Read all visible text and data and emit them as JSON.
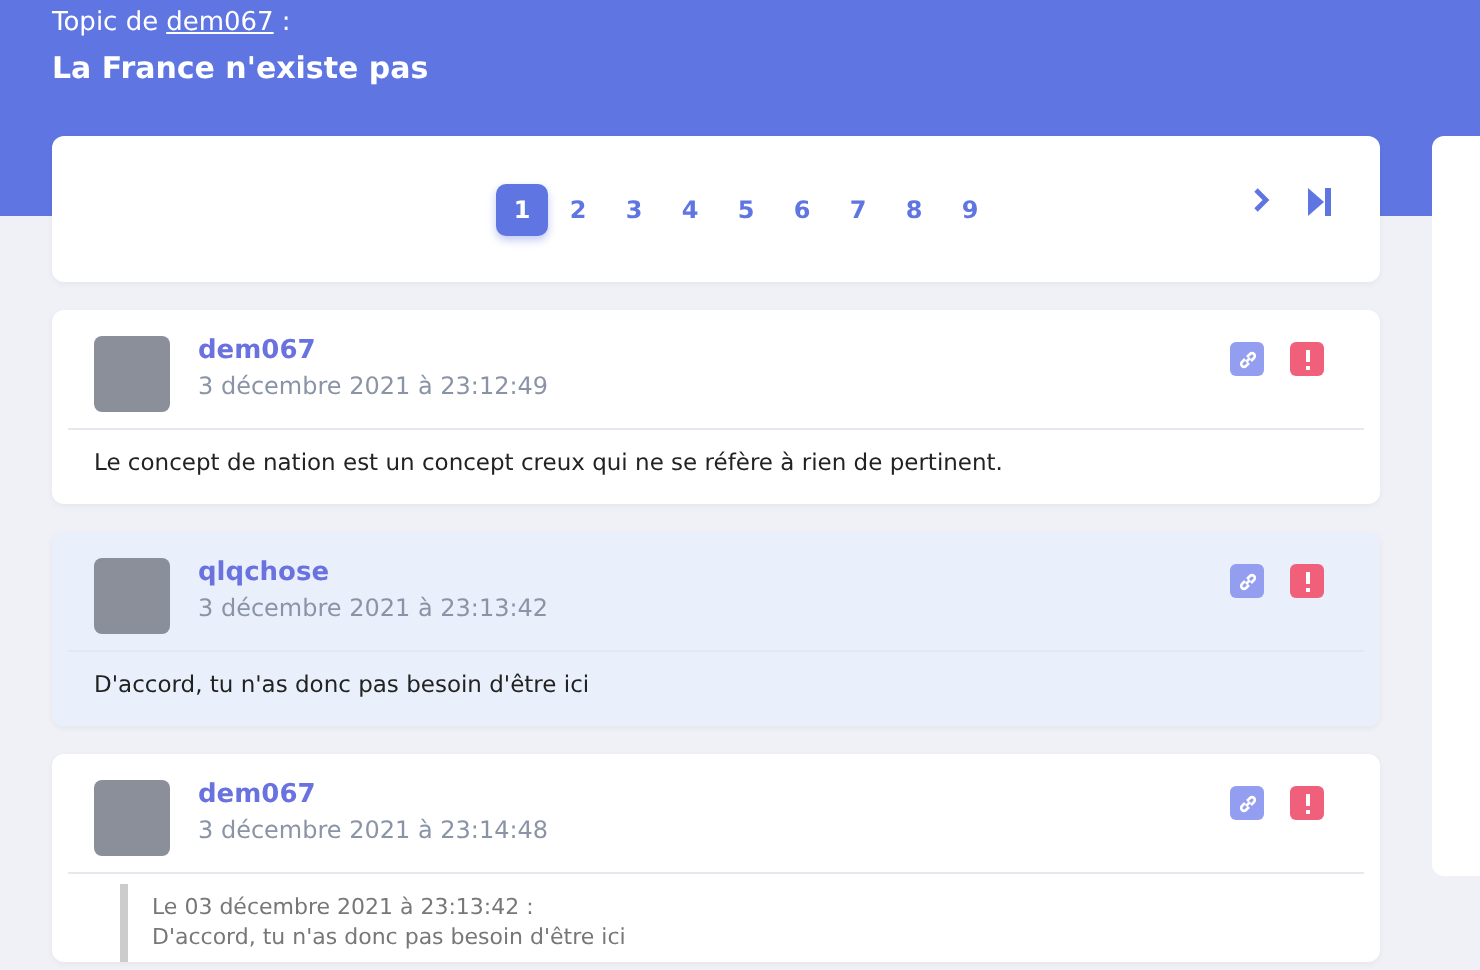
{
  "header": {
    "prefix": "Topic de",
    "author": "dem067",
    "suffix": ":",
    "title": "La France n'existe pas"
  },
  "pagination": {
    "pages": [
      {
        "label": "1",
        "selected": true
      },
      {
        "label": "2",
        "selected": false
      },
      {
        "label": "3",
        "selected": false
      },
      {
        "label": "4",
        "selected": false
      },
      {
        "label": "5",
        "selected": false
      },
      {
        "label": "6",
        "selected": false
      },
      {
        "label": "7",
        "selected": false
      },
      {
        "label": "8",
        "selected": false
      },
      {
        "label": "9",
        "selected": false
      }
    ]
  },
  "posts": [
    {
      "author": "dem067",
      "date": "3 décembre 2021 à 23:12:49",
      "highlighted": false,
      "text": "Le concept de nation est un concept creux qui ne se réfère à rien de pertinent."
    },
    {
      "author": "qlqchose",
      "date": "3 décembre 2021 à 23:13:42",
      "highlighted": true,
      "text": "D'accord, tu n'as donc pas besoin d'être ici"
    },
    {
      "author": "dem067",
      "date": "3 décembre 2021 à 23:14:48",
      "highlighted": false,
      "quote": {
        "heading": "Le 03 décembre 2021 à 23:13:42 :",
        "text": "D'accord, tu n'as donc pas besoin d'être ici"
      }
    }
  ]
}
